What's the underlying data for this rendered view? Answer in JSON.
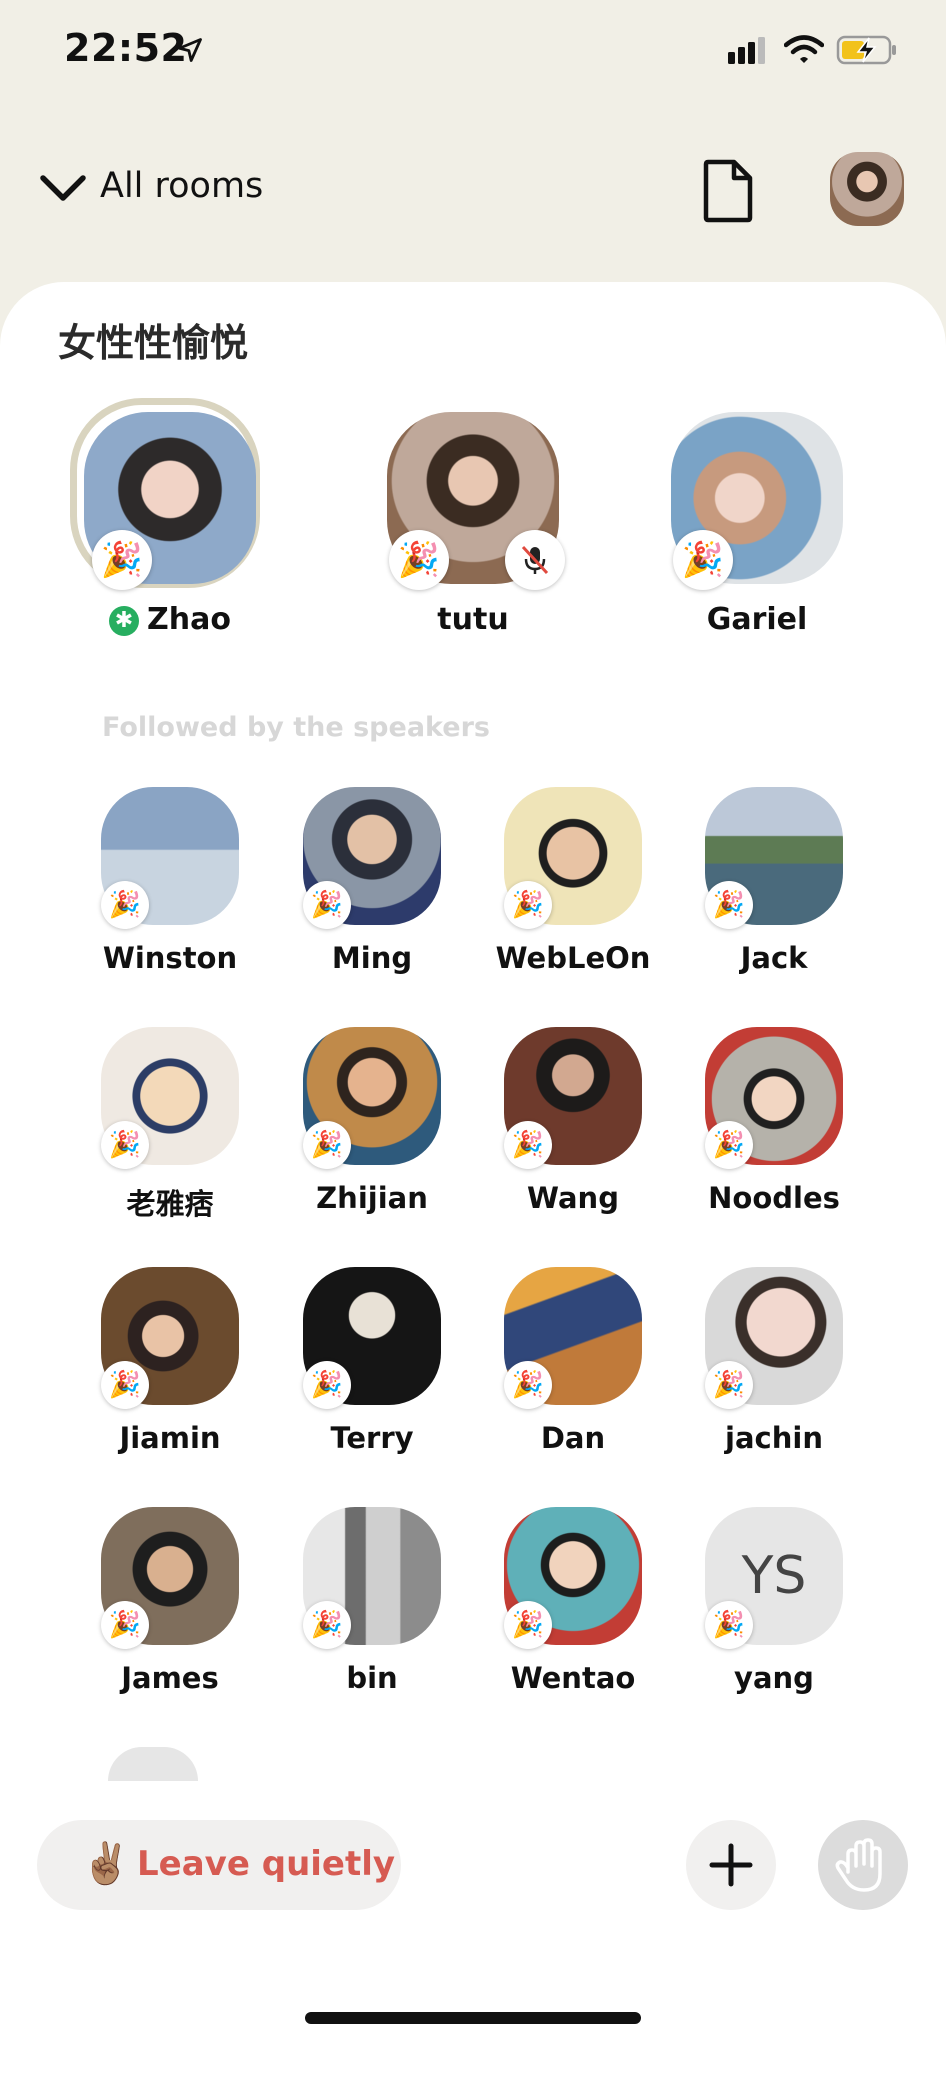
{
  "status_bar": {
    "time": "22:52"
  },
  "header": {
    "back_label": "All rooms"
  },
  "room": {
    "title": "女性性愉悦",
    "speakers": [
      {
        "name": "Zhao",
        "moderator": true,
        "speaking": true,
        "muted": false
      },
      {
        "name": "tutu",
        "moderator": false,
        "speaking": false,
        "muted": true
      },
      {
        "name": "Gariel",
        "moderator": false,
        "speaking": false,
        "muted": false
      }
    ],
    "section_label": "Followed by the speakers",
    "listeners": [
      "Winston",
      "Ming",
      "WebLeOn",
      "Jack",
      "老雅痞",
      "Zhijian",
      "Wang",
      "Noodles",
      "Jiamin",
      "Terry",
      "Dan",
      "jachin",
      "James",
      "bin",
      "Wentao",
      "yang"
    ],
    "initials_avatar": "YS",
    "badge_emoji": "🎉"
  },
  "actions": {
    "leave_emoji": "✌🏽",
    "leave_label": "Leave quietly",
    "add_icon": "plus-icon",
    "raise_hand_icon": "hand-icon"
  },
  "colors": {
    "background": "#f1efe6",
    "leave_text": "#d65b52",
    "moderator": "#27ae60"
  }
}
